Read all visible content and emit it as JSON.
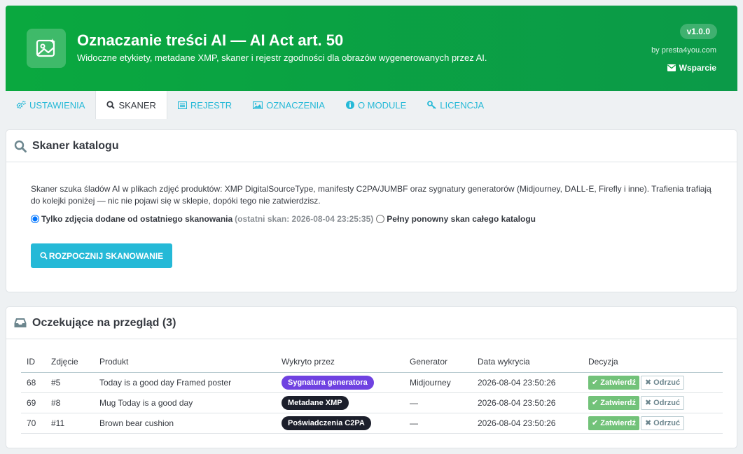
{
  "header": {
    "title": "Oznaczanie treści AI — AI Act art. 50",
    "subtitle": "Widoczne etykiety, metadane XMP, skaner i rejestr zgodności dla obrazów wygenerowanych przez AI.",
    "version": "v1.0.0",
    "by": "by presta4you.com",
    "support_label": "Wsparcie",
    "logo_icon": "image-sparkle-icon",
    "bg_color": "#0aa83f"
  },
  "tabs": [
    {
      "label": "USTAWIENIA",
      "icon": "cogs-icon",
      "active": false
    },
    {
      "label": "SKANER",
      "icon": "search-icon",
      "active": true
    },
    {
      "label": "REJESTR",
      "icon": "list-icon",
      "active": false
    },
    {
      "label": "OZNACZENIA",
      "icon": "image-icon",
      "active": false
    },
    {
      "label": "O MODULE",
      "icon": "info-icon",
      "active": false
    },
    {
      "label": "LICENCJA",
      "icon": "key-icon",
      "active": false
    }
  ],
  "scanner": {
    "title": "Skaner katalogu",
    "description": "Skaner szuka śladów AI w plikach zdjęć produktów: XMP DigitalSourceType, manifesty C2PA/JUMBF oraz sygnatury generatorów (Midjourney, DALL-E, Firefly i inne). Trafienia trafiają do kolejki poniżej — nic nie pojawi się w sklepie, dopóki tego nie zatwierdzisz.",
    "option_incremental": "Tylko zdjęcia dodane od ostatniego skanowania",
    "last_scan": "(ostatni skan: 2026-08-04 23:25:35)",
    "option_full": "Pełny ponowny skan całego katalogu",
    "selected_option": "incremental",
    "button_label": "ROZPOCZNIJ SKANOWANIE"
  },
  "review": {
    "title": "Oczekujące na przegląd (3)",
    "columns": [
      "ID",
      "Zdjęcie",
      "Produkt",
      "Wykryto przez",
      "Generator",
      "Data wykrycia",
      "Decyzja"
    ],
    "approve_label": "Zatwierdź",
    "reject_label": "Odrzuć",
    "rows": [
      {
        "id": "68",
        "photo": "#5",
        "product": "Today is a good day Framed poster",
        "detected_by": "Sygnatura generatora",
        "badge_color": "#6f42e1",
        "generator": "Midjourney",
        "date": "2026-08-04 23:50:26"
      },
      {
        "id": "69",
        "photo": "#8",
        "product": "Mug Today is a good day",
        "detected_by": "Metadane XMP",
        "badge_color": "#1c1f2b",
        "generator": "—",
        "date": "2026-08-04 23:50:26"
      },
      {
        "id": "70",
        "photo": "#11",
        "product": "Brown bear cushion",
        "detected_by": "Poświadczenia C2PA",
        "badge_color": "#1c1f2b",
        "generator": "—",
        "date": "2026-08-04 23:50:26"
      }
    ]
  }
}
